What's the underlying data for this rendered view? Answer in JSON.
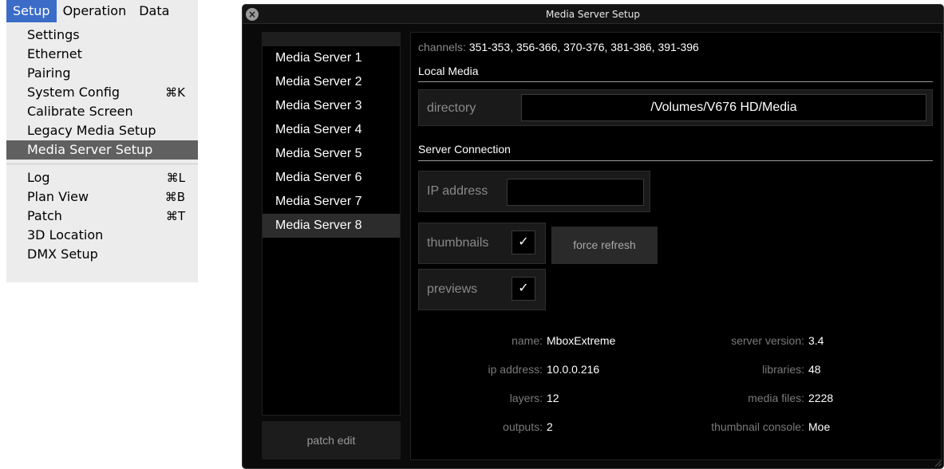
{
  "menubar": {
    "items": [
      "Setup",
      "Operation",
      "Data"
    ]
  },
  "menu": {
    "items": [
      {
        "label": "Settings",
        "shortcut": ""
      },
      {
        "label": "Ethernet",
        "shortcut": ""
      },
      {
        "label": "Pairing",
        "shortcut": ""
      },
      {
        "label": "System Config",
        "shortcut": "⌘K"
      },
      {
        "label": "Calibrate Screen",
        "shortcut": ""
      },
      {
        "label": "Legacy Media Setup",
        "shortcut": ""
      },
      {
        "label": "Media Server Setup",
        "shortcut": "",
        "selected": true
      },
      {
        "label": "Log",
        "shortcut": "⌘L"
      },
      {
        "label": "Plan View",
        "shortcut": "⌘B"
      },
      {
        "label": "Patch",
        "shortcut": "⌘T"
      },
      {
        "label": "3D Location",
        "shortcut": ""
      },
      {
        "label": "DMX Setup",
        "shortcut": ""
      }
    ]
  },
  "window": {
    "title": "Media Server Setup",
    "close_glyph": "×"
  },
  "servers": {
    "items": [
      "Media Server 1",
      "Media Server 2",
      "Media Server 3",
      "Media Server 4",
      "Media Server 5",
      "Media Server 6",
      "Media Server 7",
      "Media Server 8"
    ],
    "selected": "Media Server 8"
  },
  "patch_edit_label": "patch edit",
  "channels": {
    "label": "channels:",
    "value": "351-353, 356-366, 370-376, 381-386, 391-396"
  },
  "local_media": {
    "section_title": "Local Media",
    "directory_label": "directory",
    "directory_value": "/Volumes/V676 HD/Media"
  },
  "server_connection": {
    "section_title": "Server Connection",
    "ip_label": "IP address",
    "ip_value": ""
  },
  "thumbnails": {
    "label": "thumbnails",
    "checked": "✓"
  },
  "force_refresh_label": "force refresh",
  "previews": {
    "label": "previews",
    "checked": "✓"
  },
  "info": {
    "name_label": "name:",
    "name_value": "MboxExtreme",
    "ip_label": "ip address:",
    "ip_value": "10.0.0.216",
    "layers_label": "layers:",
    "layers_value": "12",
    "outputs_label": "outputs:",
    "outputs_value": "2",
    "version_label": "server version:",
    "version_value": "3.4",
    "libraries_label": "libraries:",
    "libraries_value": "48",
    "media_files_label": "media files:",
    "media_files_value": "2228",
    "thumb_console_label": "thumbnail console:",
    "thumb_console_value": "Moe"
  }
}
